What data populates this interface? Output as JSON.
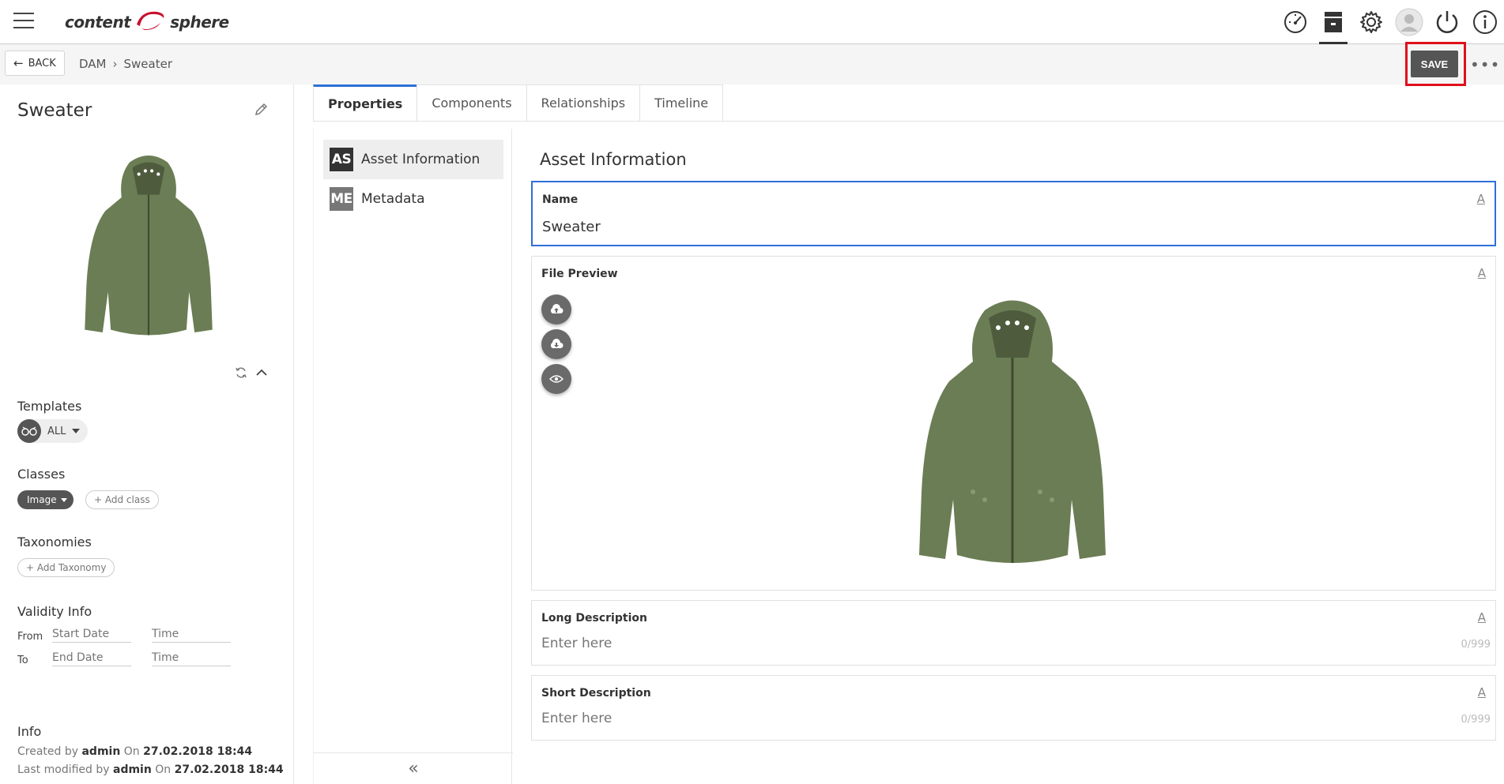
{
  "header": {
    "logo_left": "content",
    "logo_right": "sphere",
    "icons": [
      "dashboard-icon",
      "archive-icon",
      "settings-icon",
      "user-avatar-icon",
      "power-icon",
      "info-icon"
    ]
  },
  "subbar": {
    "back_label": "BACK",
    "breadcrumb": [
      "DAM",
      "Sweater"
    ],
    "save_label": "SAVE",
    "more_label": "•••"
  },
  "left": {
    "title": "Sweater",
    "templates_label": "Templates",
    "template_value": "ALL",
    "classes_label": "Classes",
    "class_value": "Image",
    "add_class": "+  Add class",
    "taxonomies_label": "Taxonomies",
    "add_taxonomy": "+  Add Taxonomy",
    "validity_label": "Validity Info",
    "from_label": "From",
    "to_label": "To",
    "start_date_placeholder": "Start Date",
    "end_date_placeholder": "End Date",
    "time_placeholder": "Time",
    "info_label": "Info",
    "created_by_label": "Created by",
    "created_by": "admin",
    "on_label": "On",
    "created_on": "27.02.2018 18:44",
    "modified_by_label": "Last modified by",
    "modified_by": "admin",
    "modified_on": "27.02.2018 18:44"
  },
  "tabs": [
    "Properties",
    "Components",
    "Relationships",
    "Timeline"
  ],
  "nav": [
    {
      "badge": "AS",
      "label": "Asset Information"
    },
    {
      "badge": "ME",
      "label": "Metadata"
    }
  ],
  "content": {
    "title": "Asset Information",
    "name_label": "Name",
    "name_value": "Sweater",
    "preview_label": "File Preview",
    "long_label": "Long Description",
    "long_placeholder": "Enter here",
    "long_counter": "0/999",
    "short_label": "Short Description",
    "short_placeholder": "Enter here",
    "short_counter": "0/999",
    "field_action": "A"
  },
  "colors": {
    "accent": "#2d6fd8",
    "save_highlight": "#e0101c",
    "badge_dark": "#333333",
    "badge_gray": "#777777",
    "sweater": "#6b7d54"
  }
}
